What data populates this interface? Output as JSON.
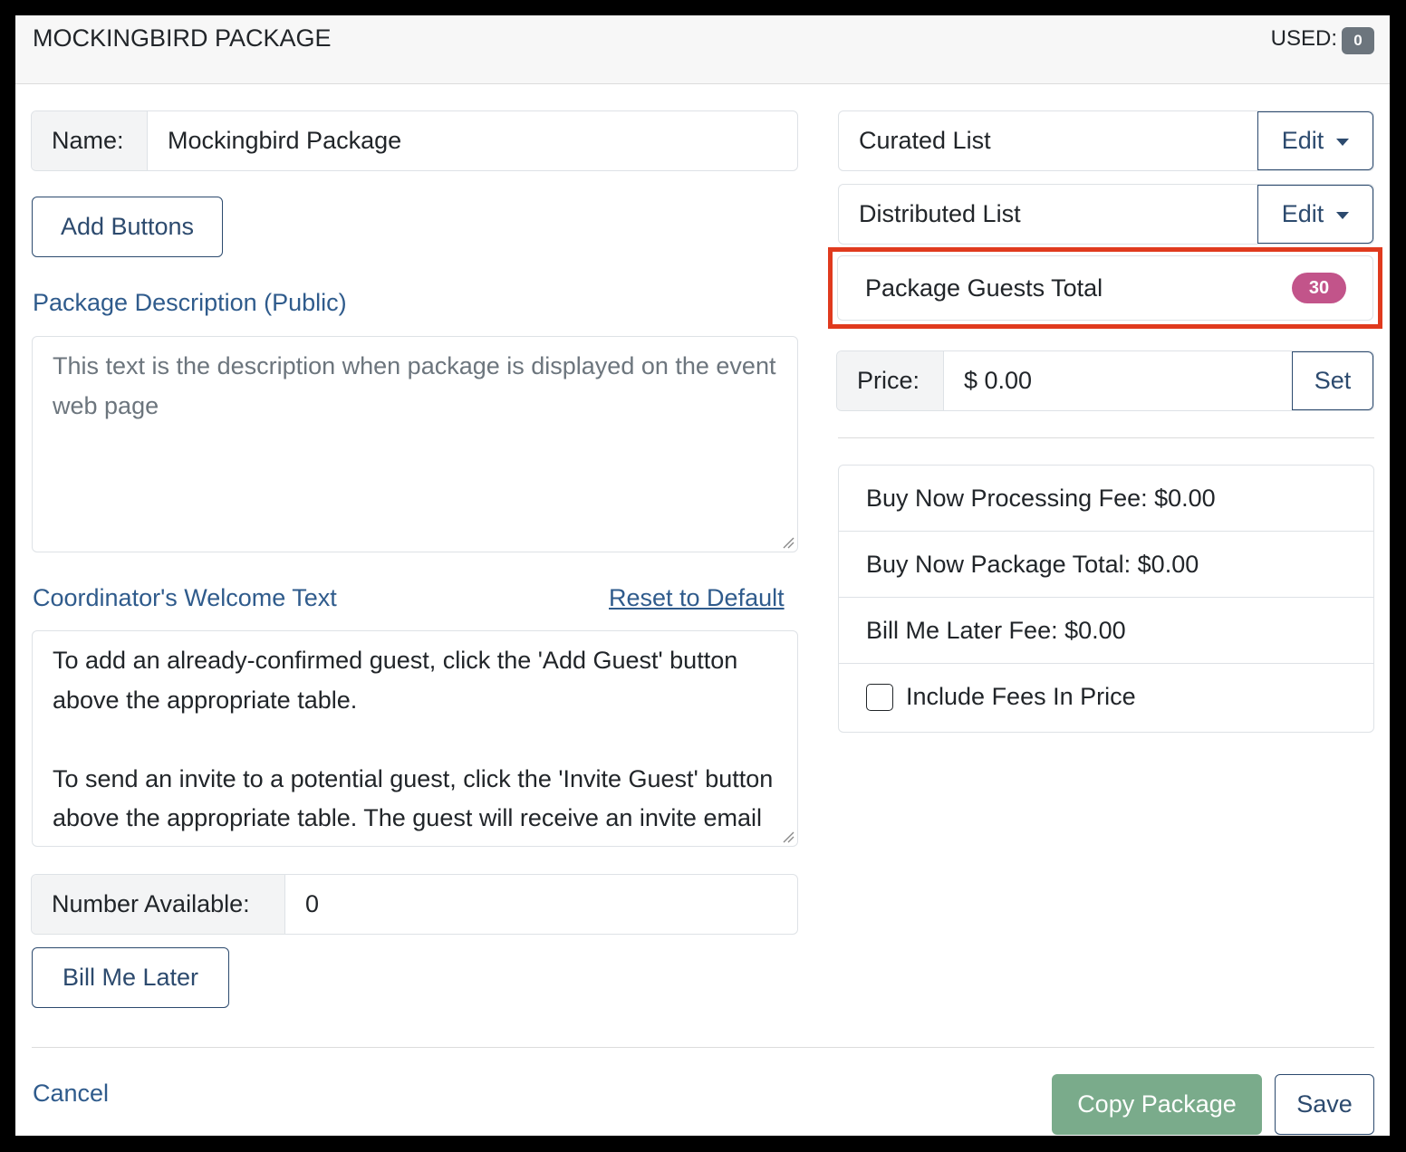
{
  "header": {
    "title": "MOCKINGBIRD PACKAGE",
    "used_label": "USED:",
    "used_count": "0"
  },
  "name_field": {
    "label": "Name:",
    "value": "Mockingbird Package"
  },
  "add_buttons_label": "Add Buttons",
  "description": {
    "label": "Package Description (Public)",
    "placeholder": "This text is the description when package is displayed on the event web page"
  },
  "welcome": {
    "label": "Coordinator's Welcome Text",
    "reset_link": "Reset to Default",
    "paragraphs": [
      "To add an already-confirmed guest, click the 'Add Guest' button above the appropriate table.",
      "To send an invite to a potential guest, click the 'Invite Guest' button above the appropriate table. The guest will receive an invite email from you with instructions to complete their registration."
    ]
  },
  "number_available": {
    "label": "Number Available:",
    "value": "0"
  },
  "bill_me_later_label": "Bill Me Later",
  "cancel_label": "Cancel",
  "lists": [
    {
      "label": "Curated List",
      "edit_label": "Edit"
    },
    {
      "label": "Distributed List",
      "edit_label": "Edit"
    }
  ],
  "guests_total": {
    "label": "Package Guests Total",
    "count": "30",
    "highlight_color": "#e03a1e",
    "badge_color": "#c2548a"
  },
  "price": {
    "label": "Price:",
    "value": "$ 0.00",
    "set_label": "Set"
  },
  "fees": {
    "processing": "Buy Now Processing Fee: $0.00",
    "package_total": "Buy Now Package Total: $0.00",
    "bill_later_fee": "Bill Me Later Fee: $0.00",
    "include_fees": "Include Fees In Price",
    "include_fees_checked": false
  },
  "footer": {
    "copy_label": "Copy Package",
    "save_label": "Save"
  },
  "colors": {
    "primary": "#2c4a6e",
    "link": "#2f5b8c",
    "success_muted": "#7aab8b"
  }
}
